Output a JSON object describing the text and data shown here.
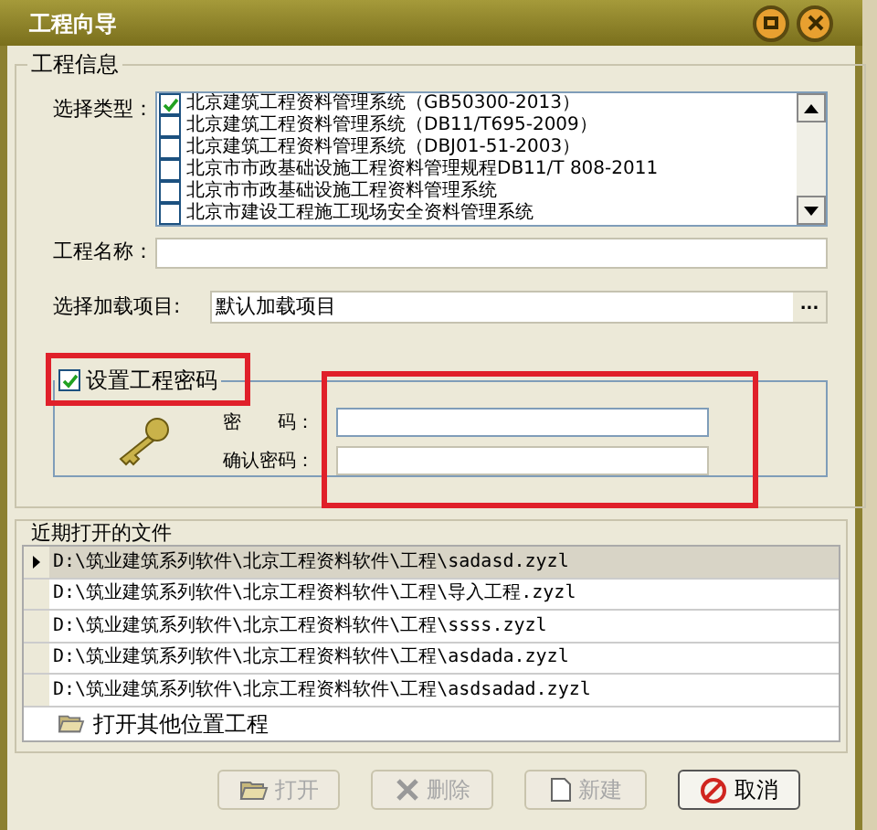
{
  "window": {
    "title": "工程向导"
  },
  "project_info": {
    "title": "工程信息",
    "type_label": "选择类型：",
    "types": [
      {
        "label": "北京建筑工程资料管理系统（GB50300-2013）",
        "checked": true
      },
      {
        "label": "北京建筑工程资料管理系统（DB11/T695-2009）",
        "checked": false
      },
      {
        "label": "北京建筑工程资料管理系统（DBJ01-51-2003）",
        "checked": false
      },
      {
        "label": "北京市市政基础设施工程资料管理规程DB11/T 808-2011",
        "checked": false
      },
      {
        "label": "北京市市政基础设施工程资料管理系统",
        "checked": false
      },
      {
        "label": "北京市建设工程施工现场安全资料管理系统",
        "checked": false
      }
    ],
    "name_label": "工程名称：",
    "load_label": "选择加载项目:",
    "load_value": "默认加载项目",
    "browse_button": "..."
  },
  "password": {
    "title": "设置工程密码",
    "checked": true,
    "password_label": "密　　码：",
    "confirm_label": "确认密码："
  },
  "recent": {
    "title": "近期打开的文件",
    "files": [
      {
        "path": "D:\\筑业建筑系列软件\\北京工程资料软件\\工程\\sadasd.zyzl",
        "selected": true
      },
      {
        "path": "D:\\筑业建筑系列软件\\北京工程资料软件\\工程\\导入工程.zyzl",
        "selected": false
      },
      {
        "path": "D:\\筑业建筑系列软件\\北京工程资料软件\\工程\\ssss.zyzl",
        "selected": false
      },
      {
        "path": "D:\\筑业建筑系列软件\\北京工程资料软件\\工程\\asdada.zyzl",
        "selected": false
      },
      {
        "path": "D:\\筑业建筑系列软件\\北京工程资料软件\\工程\\asdsadad.zyzl",
        "selected": false
      }
    ],
    "open_other": "打开其他位置工程"
  },
  "buttons": [
    {
      "label": "打开",
      "kind": "open",
      "disabled": true
    },
    {
      "label": "删除",
      "kind": "delete",
      "disabled": true
    },
    {
      "label": "新建",
      "kind": "new",
      "disabled": true
    },
    {
      "label": "取消",
      "kind": "cancel",
      "disabled": false
    }
  ]
}
